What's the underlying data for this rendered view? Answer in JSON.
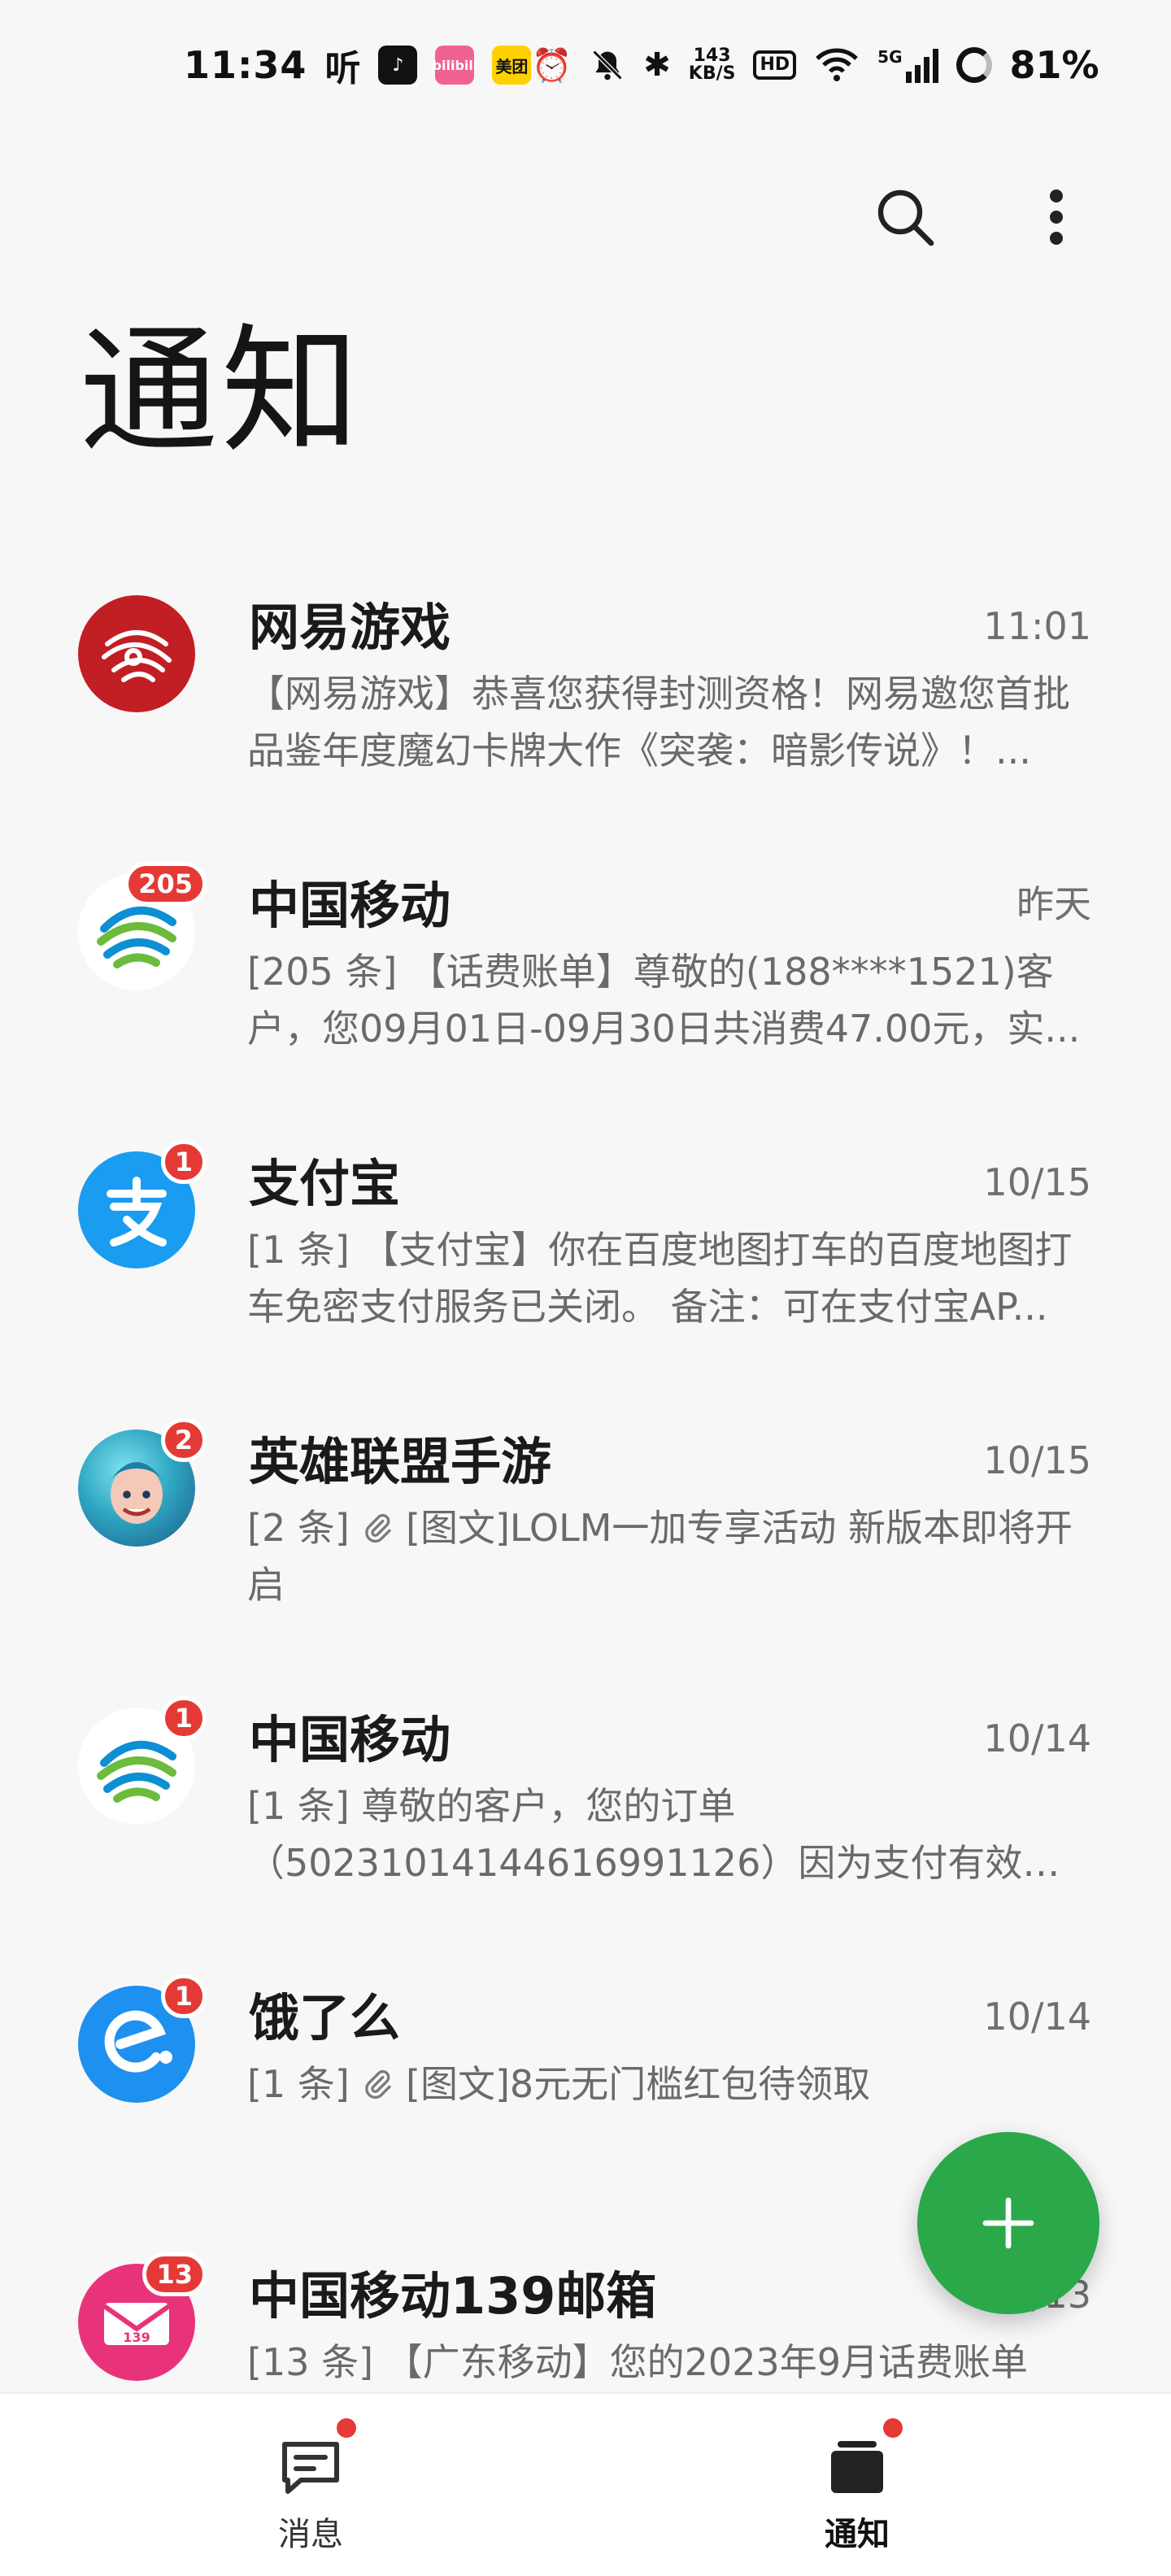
{
  "status_bar": {
    "time": "11:34",
    "ting": "听",
    "apps": [
      "tiktok-icon",
      "bilibili-icon",
      "meituan-icon"
    ],
    "meituan_label": "美团",
    "bilibili_label": "bilibili",
    "net_speed_value": "143",
    "net_speed_unit": "KB/S",
    "hd": "HD",
    "net_type": "5G",
    "battery": "81%"
  },
  "page": {
    "title": "通知"
  },
  "conversations": [
    {
      "name": "网易游戏",
      "time": "11:01",
      "badge": "",
      "preview": "【网易游戏】恭喜您获得封测资格！网易邀您首批品鉴年度魔幻卡牌大作《突袭：暗影传说》！...",
      "avatar": "netease-logo"
    },
    {
      "name": "中国移动",
      "time": "昨天",
      "badge": "205",
      "preview": "[205 条] 【话费账单】尊敬的(188****1521)客户，您09月01日-09月30日共消费47.00元，实...",
      "avatar": "china-mobile-logo"
    },
    {
      "name": "支付宝",
      "time": "10/15",
      "badge": "1",
      "preview": "[1 条] 【支付宝】你在百度地图打车的百度地图打车免密支付服务已关闭。 备注：可在支付宝AP...",
      "avatar": "alipay-logo"
    },
    {
      "name": "英雄联盟手游",
      "time": "10/15",
      "badge": "2",
      "preview_prefix": "[2 条] ",
      "preview": "[图文]LOLM一加专享活动 新版本即将开启",
      "avatar": "lol-character-avatar"
    },
    {
      "name": "中国移动",
      "time": "10/14",
      "badge": "1",
      "preview": "[1 条] 尊敬的客户，您的订单（50231014144616991126）因为支付有效期...",
      "avatar": "china-mobile-logo"
    },
    {
      "name": "饿了么",
      "time": "10/14",
      "badge": "1",
      "preview_prefix": "[1 条] ",
      "preview": "[图文]8元无门槛红包待领取",
      "avatar": "eleme-logo"
    },
    {
      "name": "中国移动139邮箱",
      "time": "10/13",
      "badge": "13",
      "preview": "[13 条] 【广东移动】您的2023年9月话费账单",
      "avatar": "139-mail-logo",
      "avatar_text": "139"
    }
  ],
  "bottom_nav": {
    "messages_label": "消息",
    "notices_label": "通知"
  },
  "colors": {
    "accent_green": "#2aa84a",
    "badge_red": "#e53935",
    "background": "#f7f7f7"
  }
}
